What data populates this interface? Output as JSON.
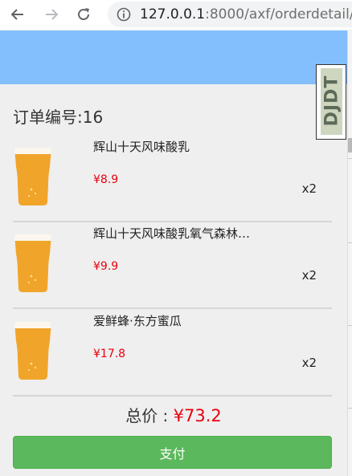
{
  "browser": {
    "address_host": "127.0.0.1",
    "address_path": ":8000/axf/orderdetail/"
  },
  "order": {
    "title": "订单编号:16"
  },
  "items": [
    {
      "name": "辉山十天风味酸乳",
      "price": "¥8.9",
      "qty": "x2"
    },
    {
      "name": "辉山十天风味酸乳氧气森林…",
      "price": "¥9.9",
      "qty": "x2"
    },
    {
      "name": "爱鲜蜂·东方蜜瓜",
      "price": "¥17.8",
      "qty": "x2"
    }
  ],
  "total": {
    "label": "总价 : ",
    "value": "¥73.2"
  },
  "pay_button": {
    "label": "支付"
  },
  "logo": {
    "text": "DJDT"
  },
  "colors": {
    "header_band": "#83bffd",
    "price_red": "#e8000e",
    "pay_green": "#5cb85c"
  },
  "icons": [
    "back-arrow-icon",
    "forward-arrow-icon",
    "reload-icon",
    "info-icon",
    "beer-glass-icon"
  ]
}
